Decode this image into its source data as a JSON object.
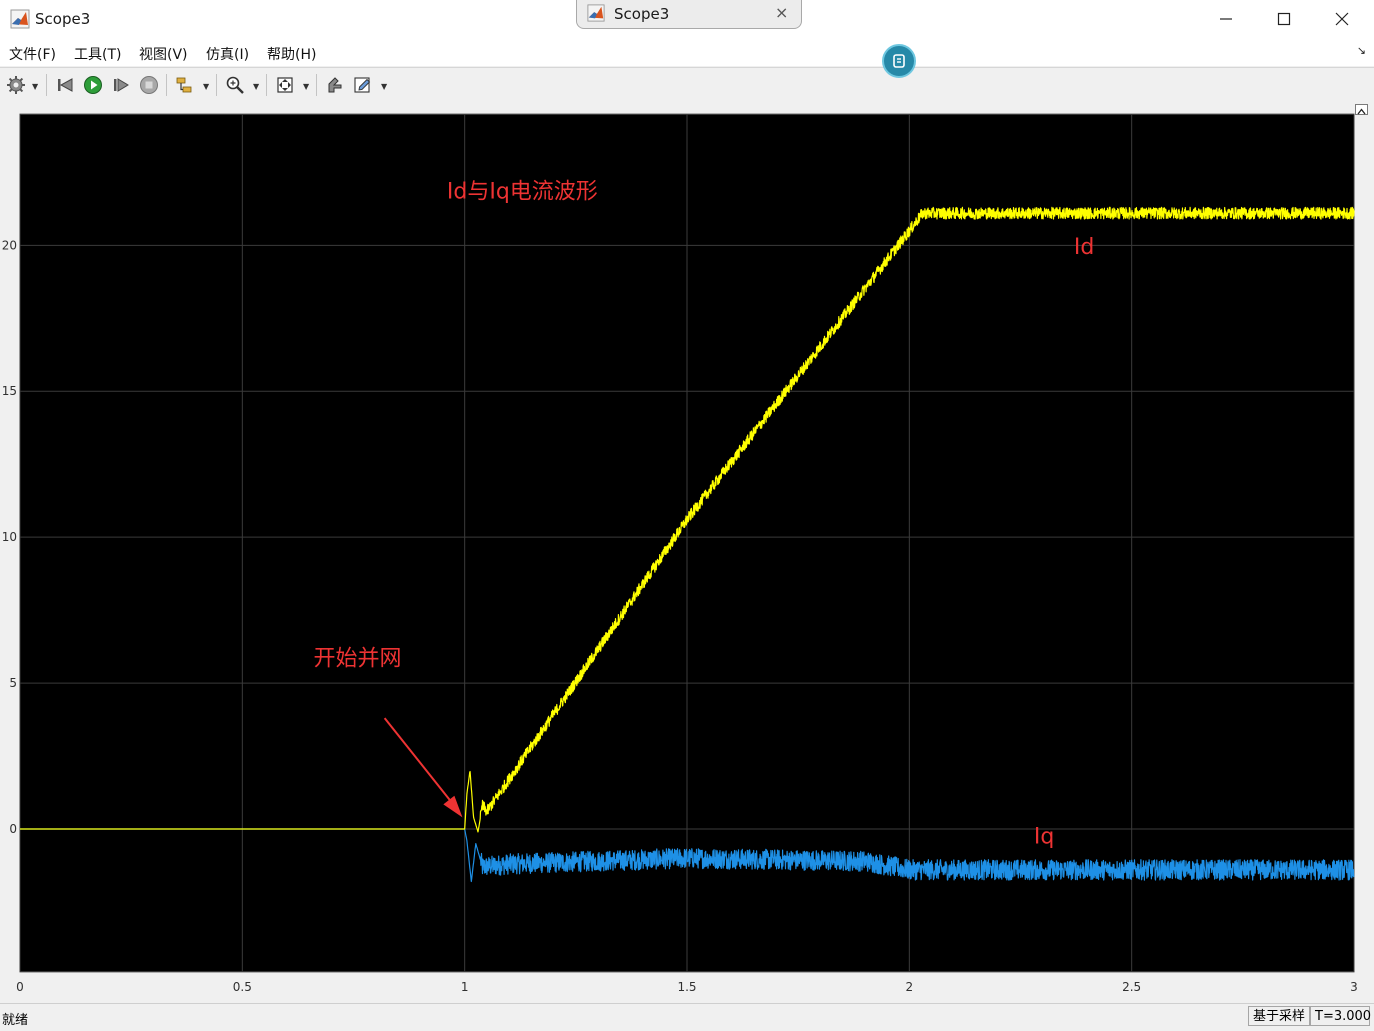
{
  "window": {
    "title": "Scope3",
    "tab_label": "Scope3",
    "tab_close": "×"
  },
  "menu": {
    "items": [
      "文件(F)",
      "工具(T)",
      "视图(V)",
      "仿真(I)",
      "帮助(H)"
    ]
  },
  "toolbar": {
    "icons": [
      "settings-icon",
      "step-back-icon",
      "run-icon",
      "step-forward-icon",
      "stop-icon",
      "signal-icon",
      "zoom-icon",
      "fit-icon",
      "pan-icon",
      "edit-icon"
    ]
  },
  "status": {
    "left": "就绪",
    "mode": "基于采样",
    "time": "T=3.000"
  },
  "colors": {
    "plot_background": "#000000",
    "grid": "#3b3b3b",
    "id_trace": "#ffff00",
    "iq_trace": "#1e90e6",
    "annotation": "#ee3333",
    "help_badge": "#2689a8"
  },
  "chart_data": {
    "type": "line",
    "title": "",
    "xlabel": "",
    "ylabel": "",
    "xlim": [
      0,
      3
    ],
    "ylim": [
      -4.9,
      24.5
    ],
    "grid": true,
    "x_ticks": [
      0,
      0.5,
      1,
      1.5,
      2,
      2.5,
      3
    ],
    "x_tick_labels": [
      "0",
      "0.5",
      "1",
      "1.5",
      "2",
      "2.5",
      "3"
    ],
    "y_ticks": [
      0,
      5,
      10,
      15,
      20
    ],
    "y_tick_labels": [
      "0",
      "5",
      "10",
      "15",
      "20"
    ],
    "series": [
      {
        "name": "Id",
        "color": "#ffff00",
        "noise": 0.2,
        "x": [
          0,
          1.0,
          1.005,
          1.012,
          1.02,
          1.03,
          1.04,
          1.05,
          1.5,
          2.0,
          2.03,
          3.0
        ],
        "y": [
          0,
          0,
          1.2,
          2.0,
          0.4,
          -0.1,
          0.8,
          0.6,
          10.6,
          20.5,
          21.1,
          21.1
        ]
      },
      {
        "name": "Iq",
        "color": "#1e90e6",
        "noise": 0.35,
        "x": [
          0,
          1.0,
          1.005,
          1.015,
          1.025,
          1.04,
          1.1,
          1.5,
          1.9,
          2.0,
          3.0
        ],
        "y": [
          0,
          0,
          -0.4,
          -1.8,
          -0.5,
          -1.3,
          -1.2,
          -1.0,
          -1.1,
          -1.4,
          -1.4
        ]
      }
    ],
    "annotations": [
      {
        "text": "Id与Iq电流波形",
        "x": 0.96,
        "y": 21.6
      },
      {
        "text": "Id",
        "x": 2.37,
        "y": 19.7
      },
      {
        "text": "开始并网",
        "x": 0.66,
        "y": 5.6
      },
      {
        "text": "Iq",
        "x": 2.28,
        "y": -0.5
      }
    ],
    "arrow": {
      "from": [
        0.82,
        3.8
      ],
      "to": [
        0.995,
        0.4
      ]
    }
  }
}
